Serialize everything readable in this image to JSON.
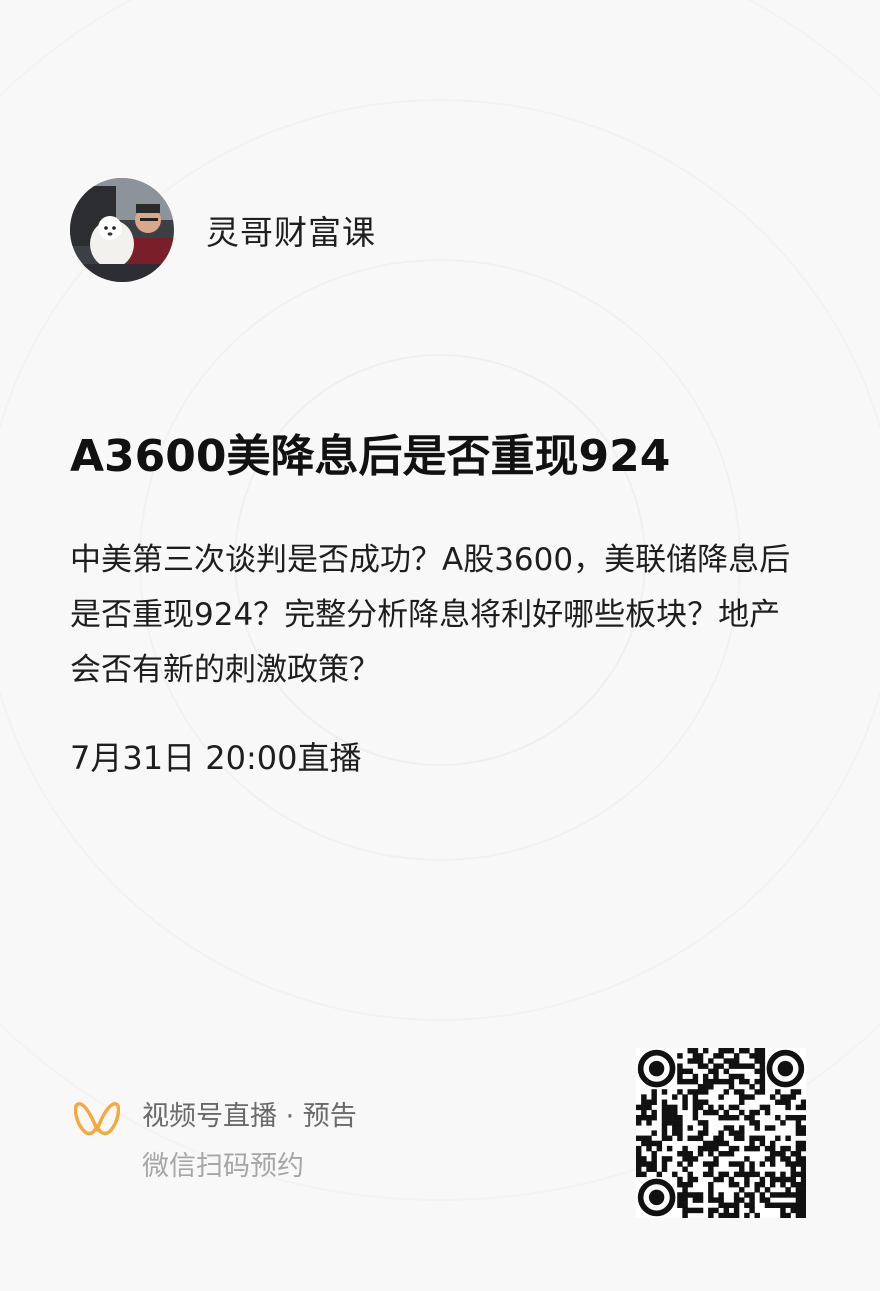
{
  "account": {
    "name": "灵哥财富课"
  },
  "live": {
    "title": "A3600美降息后是否重现924",
    "description": "中美第三次谈判是否成功？A股3600，美联储降息后是否重现924？完整分析降息将利好哪些板块？地产会否有新的刺激政策？",
    "schedule": "7月31日 20:00直播"
  },
  "footer": {
    "channel_label": "视频号直播 · 预告",
    "action_hint": "微信扫码预约"
  },
  "icons": {
    "brand": "channels-butterfly-icon",
    "qr": "qr-code"
  },
  "colors": {
    "brand_orange": "#f6a83a",
    "background": "#f8f8f8"
  }
}
